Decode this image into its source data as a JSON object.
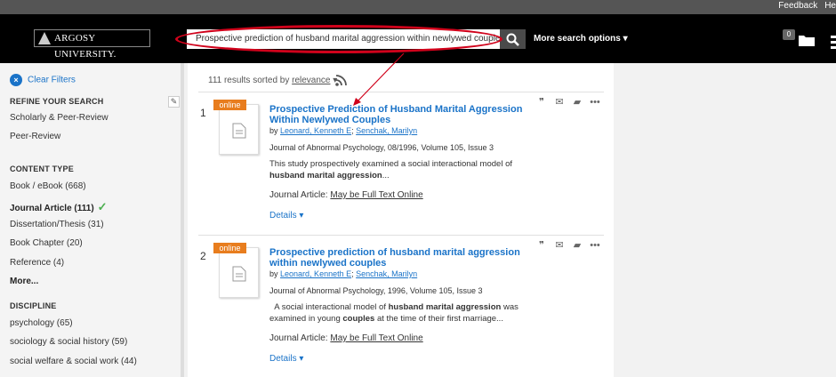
{
  "topbar": {
    "links": [
      "Feedback",
      "He"
    ]
  },
  "header": {
    "logo_text": "ARGOSY UNIVERSITY.",
    "search_value": "Prospective prediction of husband marital aggression within newlywed couples",
    "more_options": "More search options",
    "folder_count": "0"
  },
  "sidebar": {
    "clear_filters": "Clear Filters",
    "refine_heading": "REFINE YOUR SEARCH",
    "refine_items": [
      "Scholarly & Peer-Review",
      "Peer-Review"
    ],
    "content_type_heading": "CONTENT TYPE",
    "content_items": [
      {
        "label": "Book / eBook (668)"
      },
      {
        "label": "Journal Article (111)"
      },
      {
        "label": "Dissertation/Thesis (31)"
      },
      {
        "label": "Book Chapter (20)"
      },
      {
        "label": "Reference (4)"
      },
      {
        "label": "More..."
      }
    ],
    "discipline_heading": "DISCIPLINE",
    "discipline_items": [
      {
        "label": "psychology (65)"
      },
      {
        "label": "sociology & social history (59)"
      },
      {
        "label": "social welfare & social work (44)"
      }
    ]
  },
  "results": {
    "summary": "111 results sorted by",
    "sort": "relevance",
    "items": [
      {
        "number": "1",
        "badge": "online",
        "title": "Prospective Prediction of Husband Marital Aggression Within Newlywed Couples",
        "by": "by",
        "author1": "Leonard, Kenneth E",
        "sep": ";",
        "author2": "Senchak, Marilyn",
        "journal": "Journal of Abnormal Psychology, 08/1996, Volume 105, Issue 3",
        "snippet_a": "This study prospectively examined a social interactional model of",
        "snippet_b": "husband marital aggression",
        "snippet_c": "...",
        "ft_prefix": "Journal Article:",
        "ft_link": "May be Full Text Online",
        "details": "Details"
      },
      {
        "number": "2",
        "badge": "online",
        "title": "Prospective prediction of husband marital aggression within newlywed couples",
        "by": "by",
        "author1": "Leonard, Kenneth E",
        "sep": ";",
        "author2": "Senchak, Marilyn",
        "journal": "Journal of Abnormal Psychology, 1996, Volume 105, Issue 3",
        "snippet_a": "A social interactional model of",
        "snippet_b": "husband marital aggression",
        "snippet_c": "was examined in young",
        "snippet_d": "couples",
        "snippet_e": "at the time of their first marriage...",
        "ft_prefix": "Journal Article:",
        "ft_link": "May be Full Text Online",
        "details": "Details"
      }
    ]
  },
  "colors": {
    "link": "#1a73c8",
    "badge": "#e87d1e",
    "annotation": "#d0021b",
    "check": "#4caf50"
  },
  "icons": [
    "search-icon",
    "folder-icon",
    "menu-icon",
    "rss-icon",
    "quote-icon",
    "email-icon",
    "add-folder-icon",
    "more-icon",
    "document-icon",
    "check-icon",
    "close-icon",
    "pencil-icon"
  ]
}
